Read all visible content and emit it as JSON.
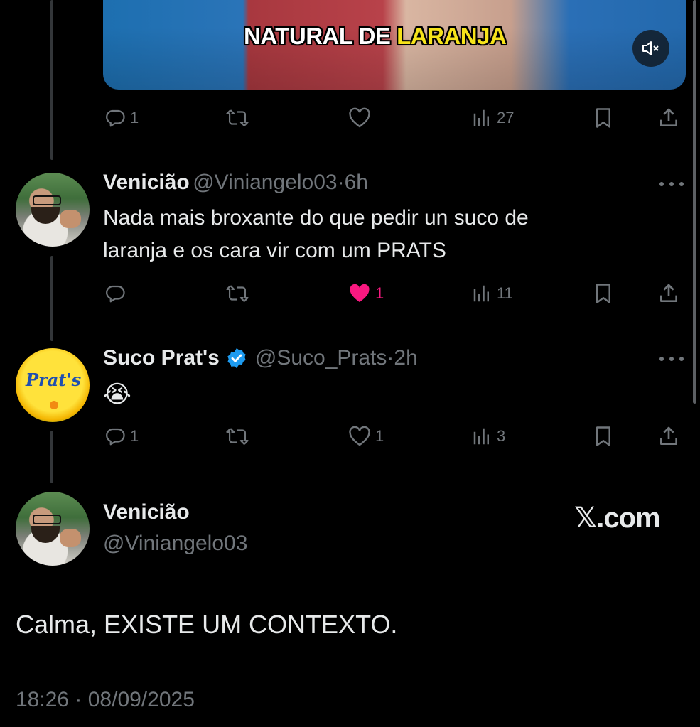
{
  "media": {
    "caption_white": "NATURAL DE",
    "caption_yellow": "LARANJA",
    "mute_icon": "mute-icon"
  },
  "tweet0": {
    "actions": {
      "replies": "1",
      "retweets": "",
      "likes": "",
      "views": "27"
    }
  },
  "tweet1": {
    "name": "Venicião",
    "handle": "@Viniangelo03",
    "sep": "·",
    "time": "6h",
    "text_line1": "Nada mais broxante do que pedir un suco de",
    "text_line2": "laranja e os cara vir com um PRATS",
    "actions": {
      "replies": "",
      "retweets": "",
      "likes": "1",
      "views": "11"
    },
    "like_color": "#f91880"
  },
  "tweet2": {
    "name": "Suco Prat's",
    "verified": true,
    "handle": "@Suco_Prats",
    "sep": "·",
    "time": "2h",
    "text": "😭",
    "avatar_logo": "Prat's",
    "actions": {
      "replies": "1",
      "retweets": "",
      "likes": "1",
      "views": "3"
    },
    "verified_color": "#1d9bf0"
  },
  "reply": {
    "name": "Venicião",
    "handle": "@Viniangelo03",
    "watermark": "𝕏.com",
    "text": "Calma, EXISTE UM CONTEXTO.",
    "timestamp": "18:26 · 08/09/2025"
  },
  "colors": {
    "background": "#000000",
    "text": "#e7e9ea",
    "muted": "#71767b",
    "thread_line": "#333639"
  }
}
